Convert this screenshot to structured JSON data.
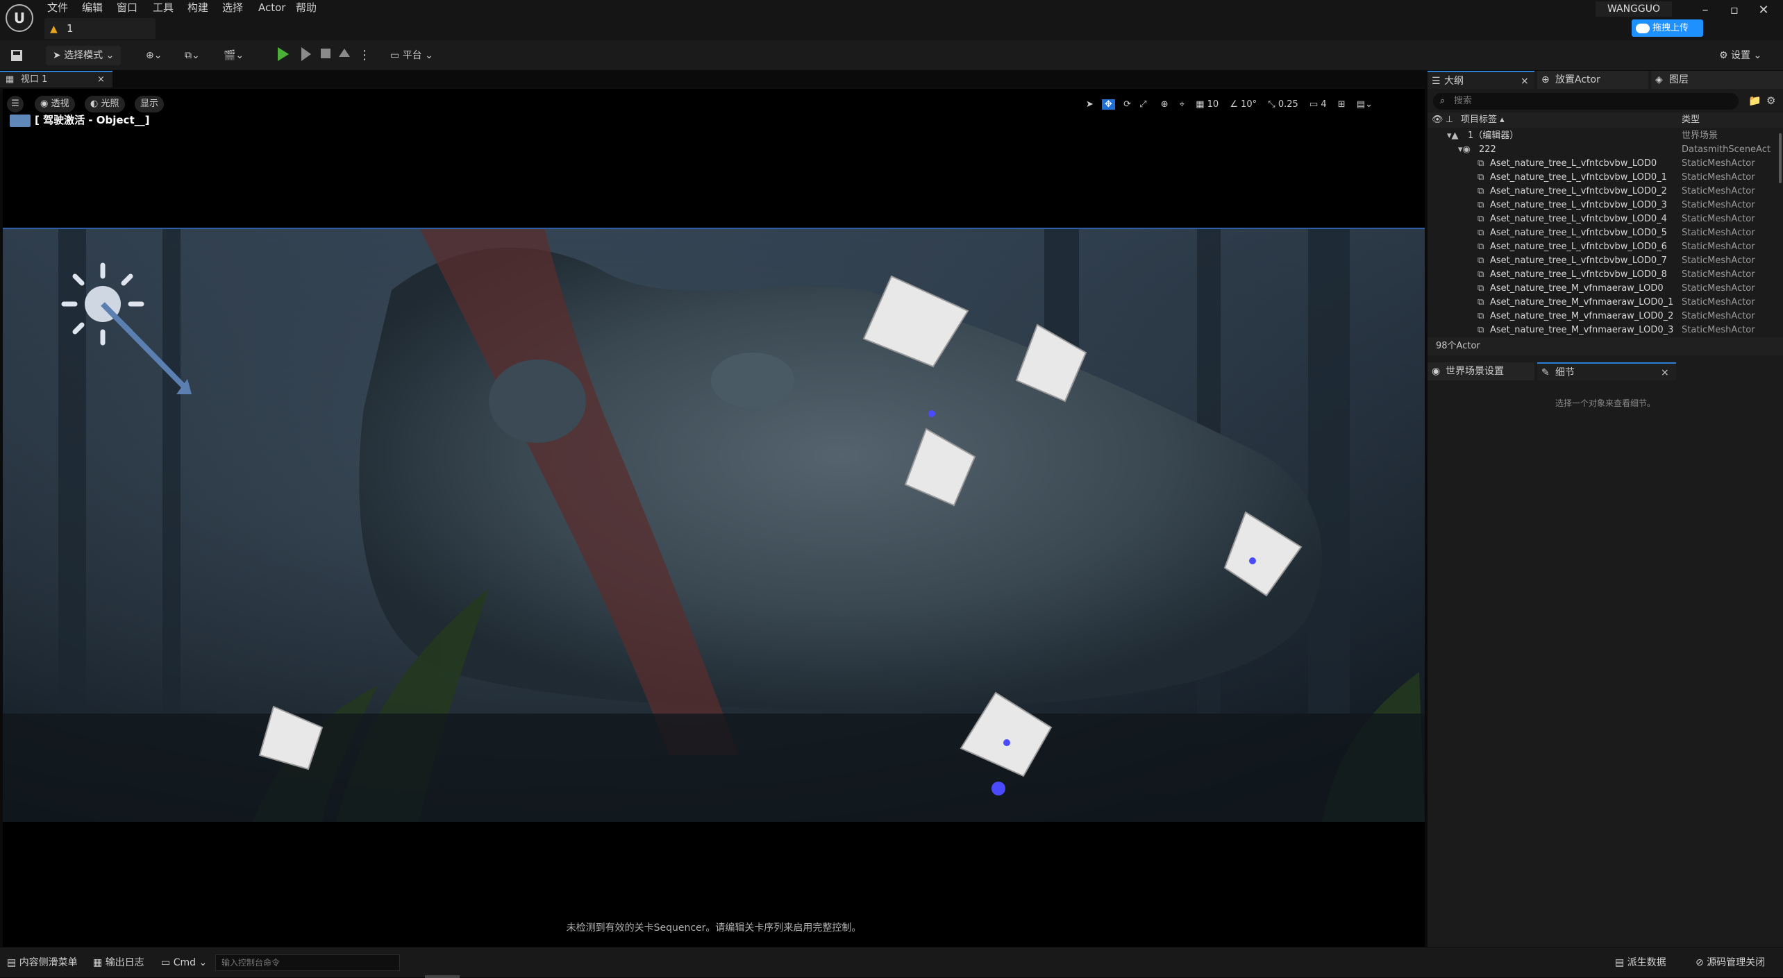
{
  "menu": [
    "文件",
    "编辑",
    "窗口",
    "工具",
    "构建",
    "选择",
    "Actor",
    "帮助"
  ],
  "project_tab": {
    "warn_icon": "warning-icon",
    "label": "1"
  },
  "user": "WANGGUO",
  "upload_label": "拖拽上传",
  "toolbar": {
    "select_mode": "选择模式",
    "platform": "平台",
    "settings": "设置"
  },
  "viewport": {
    "tab_label": "视口 1",
    "perspective": "透视",
    "lighting": "光照",
    "show": "显示",
    "object_label": "[ 驾驶激活 - Object__]",
    "grid_snap": "10",
    "rot_snap": "10°",
    "scale_snap": "0.25",
    "cam_speed": "4",
    "sequencer_msg": "未检测到有效的关卡Sequencer。请编辑关卡序列来启用完整控制。"
  },
  "outliner": {
    "tabs": [
      "大纲",
      "放置Actor",
      "图层"
    ],
    "search_placeholder": "搜索",
    "col_label": "项目标签",
    "col_type": "类型",
    "rows": [
      {
        "name": "1（编辑器）",
        "type": "世界场景"
      },
      {
        "name": "222",
        "type": "DatasmithSceneAct"
      },
      {
        "name": "Aset_nature_tree_L_vfntcbvbw_LOD0",
        "type": "StaticMeshActor"
      },
      {
        "name": "Aset_nature_tree_L_vfntcbvbw_LOD0_1",
        "type": "StaticMeshActor"
      },
      {
        "name": "Aset_nature_tree_L_vfntcbvbw_LOD0_2",
        "type": "StaticMeshActor"
      },
      {
        "name": "Aset_nature_tree_L_vfntcbvbw_LOD0_3",
        "type": "StaticMeshActor"
      },
      {
        "name": "Aset_nature_tree_L_vfntcbvbw_LOD0_4",
        "type": "StaticMeshActor"
      },
      {
        "name": "Aset_nature_tree_L_vfntcbvbw_LOD0_5",
        "type": "StaticMeshActor"
      },
      {
        "name": "Aset_nature_tree_L_vfntcbvbw_LOD0_6",
        "type": "StaticMeshActor"
      },
      {
        "name": "Aset_nature_tree_L_vfntcbvbw_LOD0_7",
        "type": "StaticMeshActor"
      },
      {
        "name": "Aset_nature_tree_L_vfntcbvbw_LOD0_8",
        "type": "StaticMeshActor"
      },
      {
        "name": "Aset_nature_tree_M_vfnmaeraw_LOD0",
        "type": "StaticMeshActor"
      },
      {
        "name": "Aset_nature_tree_M_vfnmaeraw_LOD0_1",
        "type": "StaticMeshActor"
      },
      {
        "name": "Aset_nature_tree_M_vfnmaeraw_LOD0_2",
        "type": "StaticMeshActor"
      },
      {
        "name": "Aset_nature_tree_M_vfnmaeraw_LOD0_3",
        "type": "StaticMeshActor"
      }
    ],
    "actor_count": "98个Actor"
  },
  "details": {
    "tabs": [
      "世界场景设置",
      "细节"
    ],
    "empty_msg": "选择一个对象来查看细节。"
  },
  "statusbar": {
    "content_drawer": "内容侧滑菜单",
    "output_log": "输出日志",
    "cmd": "Cmd",
    "cmd_placeholder": "输入控制台命令",
    "derived_data": "派生数据",
    "source_control": "源码管理关闭"
  }
}
